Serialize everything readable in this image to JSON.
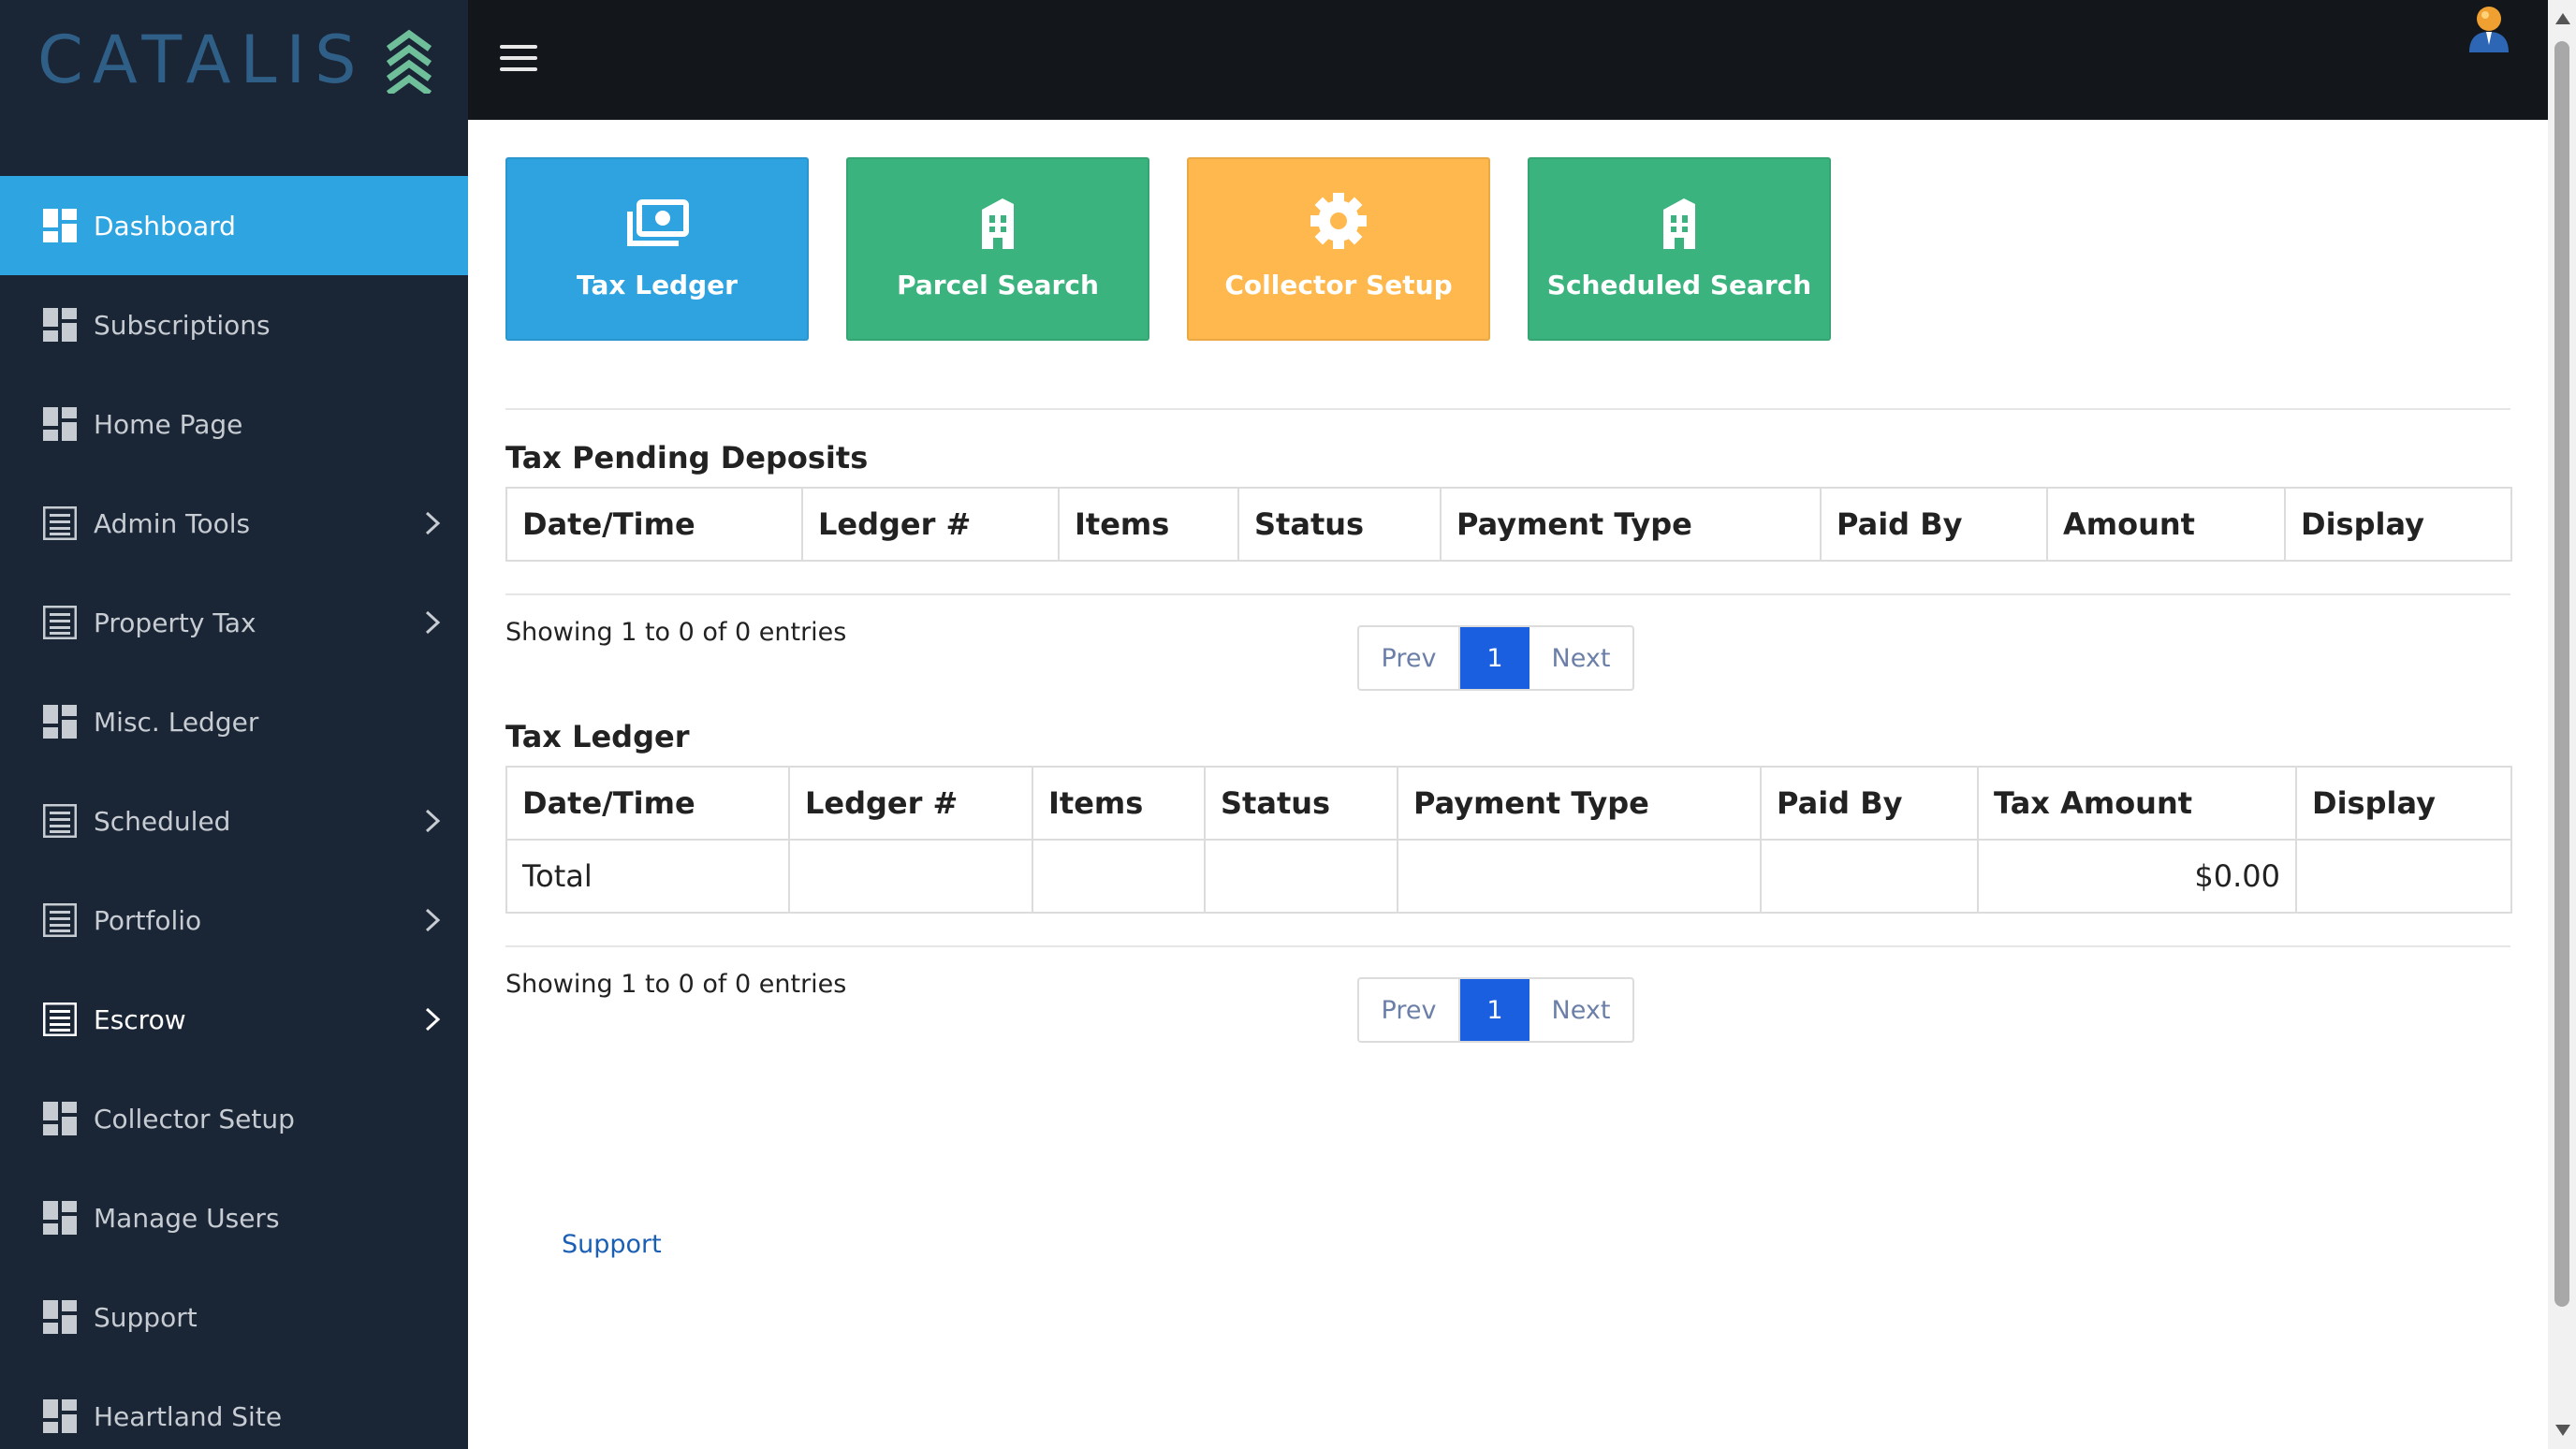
{
  "brand": {
    "logo_text": "CATALIS"
  },
  "sidebar": {
    "items": [
      {
        "label": "Dashboard",
        "icon": "dashboard-grid-icon",
        "has_chevron": false
      },
      {
        "label": "Subscriptions",
        "icon": "dashboard-grid-icon",
        "has_chevron": false
      },
      {
        "label": "Home Page",
        "icon": "dashboard-grid-icon",
        "has_chevron": false
      },
      {
        "label": "Admin Tools",
        "icon": "list-icon",
        "has_chevron": true
      },
      {
        "label": "Property Tax",
        "icon": "list-icon",
        "has_chevron": true
      },
      {
        "label": "Misc. Ledger",
        "icon": "dashboard-grid-icon",
        "has_chevron": false
      },
      {
        "label": "Scheduled",
        "icon": "list-icon",
        "has_chevron": true
      },
      {
        "label": "Portfolio",
        "icon": "list-icon",
        "has_chevron": true
      },
      {
        "label": "Escrow",
        "icon": "list-icon",
        "has_chevron": true
      },
      {
        "label": "Collector Setup",
        "icon": "dashboard-grid-icon",
        "has_chevron": false
      },
      {
        "label": "Manage Users",
        "icon": "dashboard-grid-icon",
        "has_chevron": false
      },
      {
        "label": "Support",
        "icon": "dashboard-grid-icon",
        "has_chevron": false
      },
      {
        "label": "Heartland Site",
        "icon": "dashboard-grid-icon",
        "has_chevron": false
      }
    ]
  },
  "tiles": [
    {
      "label": "Tax Ledger",
      "icon": "money-icon",
      "color": "#2fa3e0"
    },
    {
      "label": "Parcel Search",
      "icon": "building-icon",
      "color": "#3bb37e"
    },
    {
      "label": "Collector Setup",
      "icon": "gear-icon",
      "color": "#ffb84d"
    },
    {
      "label": "Scheduled Search",
      "icon": "building-icon",
      "color": "#3bb37e"
    }
  ],
  "pending_deposits": {
    "title": "Tax Pending Deposits",
    "columns": [
      "Date/Time",
      "Ledger #",
      "Items",
      "Status",
      "Payment Type",
      "Paid By",
      "Amount",
      "Display"
    ],
    "entries_text": "Showing 1 to 0 of 0 entries",
    "pager": {
      "prev": "Prev",
      "page": "1",
      "next": "Next"
    }
  },
  "tax_ledger": {
    "title": "Tax Ledger",
    "columns": [
      "Date/Time",
      "Ledger #",
      "Items",
      "Status",
      "Payment Type",
      "Paid By",
      "Tax Amount",
      "Display"
    ],
    "total_row": {
      "label": "Total",
      "amount": "$0.00"
    },
    "entries_text": "Showing 1 to 0 of 0 entries",
    "pager": {
      "prev": "Prev",
      "page": "1",
      "next": "Next"
    }
  },
  "footer": {
    "support_link": "Support"
  },
  "colors": {
    "sidebar_bg": "#1a2535",
    "active": "#2ea5e0",
    "topbar_bg": "#13161b",
    "pager_active": "#1a5fe0"
  }
}
